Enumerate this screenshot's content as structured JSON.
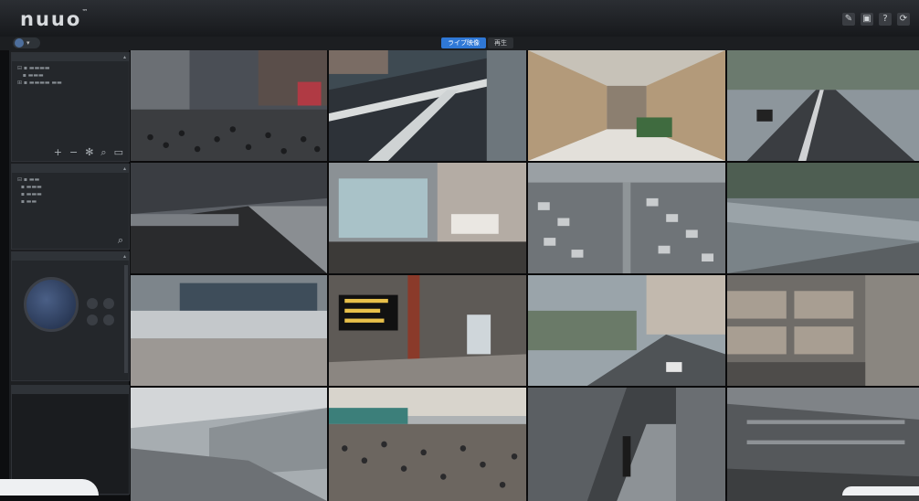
{
  "app": {
    "logo_text": "nuuo",
    "logo_mark": "™"
  },
  "toolbar": {
    "icons": [
      "wrench-icon",
      "monitor-icon",
      "help-icon",
      "power-icon"
    ],
    "help_glyph": "?"
  },
  "modes": {
    "live": "ライブ映像",
    "playback": "再生"
  },
  "colors": {
    "accent": "#2f78d6",
    "background": "#0d0e10",
    "panel": "#24272b"
  }
}
